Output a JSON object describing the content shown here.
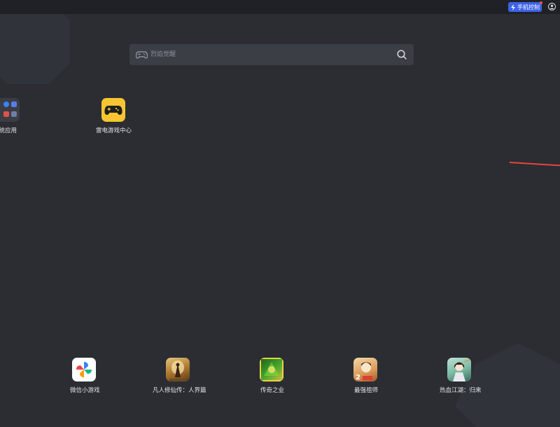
{
  "topbar": {
    "phone_control_label": "手机控制",
    "icons": [
      "lightning-icon",
      "user-icon"
    ]
  },
  "search": {
    "placeholder": "烈焰觉醒",
    "icons": [
      "gamepad-icon",
      "search-icon"
    ]
  },
  "desktop_apps": [
    {
      "label": "系统应用"
    },
    {
      "label": "雷电游戏中心"
    }
  ],
  "dock_apps": [
    {
      "label": "微信小游戏"
    },
    {
      "label": "凡人修仙传：人界篇"
    },
    {
      "label": "传奇之业"
    },
    {
      "label": "最强祖师"
    },
    {
      "label": "热血江湖：归来"
    }
  ],
  "colors": {
    "background": "#2b2d33",
    "topbar": "#1f2126",
    "search_bg": "#3b3e45",
    "accent_blue": "#3d63e8",
    "game_center_yellow": "#f7c531"
  }
}
